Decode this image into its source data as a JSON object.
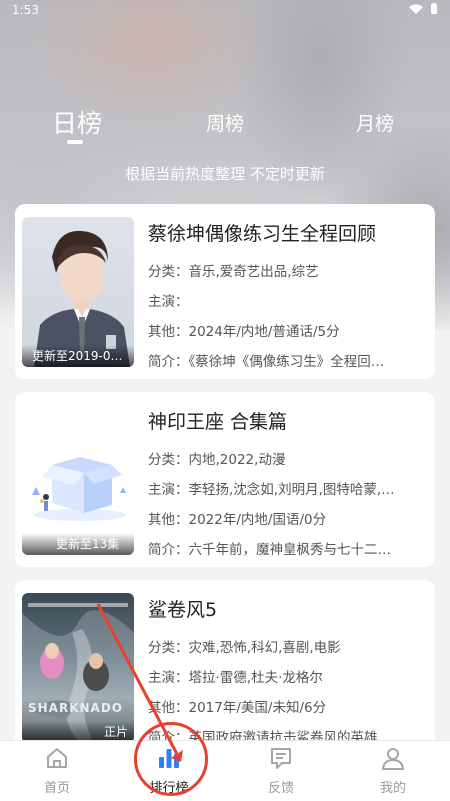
{
  "status": {
    "time": "1:53",
    "icons": "wifi-icon battery-icon"
  },
  "tabs": [
    {
      "label": "日榜",
      "active": true
    },
    {
      "label": "周榜",
      "active": false
    },
    {
      "label": "月榜",
      "active": false
    }
  ],
  "subtitle": "根据当前热度整理 不定时更新",
  "cards": [
    {
      "title": "蔡徐坤偶像练习生全程回顾",
      "poster_caption": "更新至2019-0…",
      "category": "分类：音乐,爱奇艺出品,综艺",
      "cast": "主演：",
      "other": "其他：2024年/内地/普通话/5分",
      "intro": "简介：《蔡徐坤《偶像练习生》全程回…"
    },
    {
      "title": "神印王座 合集篇",
      "poster_caption": "更新至13集",
      "category": "分类：内地,2022,动漫",
      "cast": "主演：李轻扬,沈念如,刘明月,图特哈蒙,…",
      "other": "其他：2022年/内地/国语/0分",
      "intro": "简介：六千年前，魔神皇枫秀与七十二…"
    },
    {
      "title": "鲨卷风5",
      "poster_caption": "正片",
      "poster_text": "SHARKNADO",
      "category": "分类：灾难,恐怖,科幻,喜剧,电影",
      "cast": "主演：塔拉·雷德,杜夫·龙格尔",
      "other": "其他：2017年/美国/未知/6分",
      "intro": "简介：英国政府邀请抗击鲨卷风的英雄…"
    }
  ],
  "tabbar": [
    {
      "label": "首页",
      "icon": "home-icon",
      "active": false
    },
    {
      "label": "排行榜",
      "icon": "bar-chart-icon",
      "active": true
    },
    {
      "label": "反馈",
      "icon": "feedback-icon",
      "active": false
    },
    {
      "label": "我的",
      "icon": "user-icon",
      "active": false
    }
  ],
  "colors": {
    "accent_blue": "#2f7ff5",
    "annotation_red": "#e8402e"
  }
}
